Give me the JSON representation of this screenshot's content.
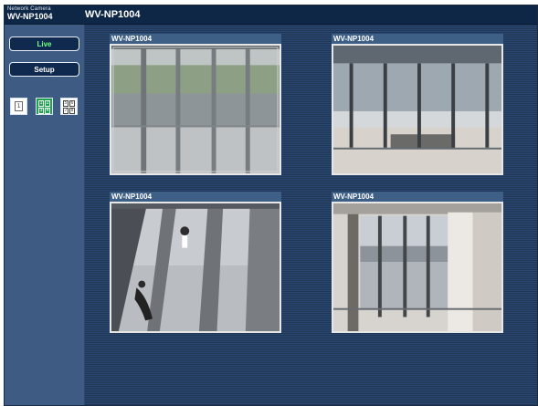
{
  "app": {
    "brand_small": "Network Camera",
    "brand_big": "WV-NP1004",
    "title": "WV-NP1004"
  },
  "sidebar": {
    "live_label": "Live",
    "setup_label": "Setup",
    "screens": {
      "single": "1",
      "quad": [
        "1",
        "2",
        "3",
        "4"
      ],
      "multi": [
        "5",
        "6",
        "7",
        "8"
      ]
    }
  },
  "cameras": [
    {
      "title": "WV-NP1004"
    },
    {
      "title": "WV-NP1004"
    },
    {
      "title": "WV-NP1004"
    },
    {
      "title": "WV-NP1004"
    }
  ]
}
